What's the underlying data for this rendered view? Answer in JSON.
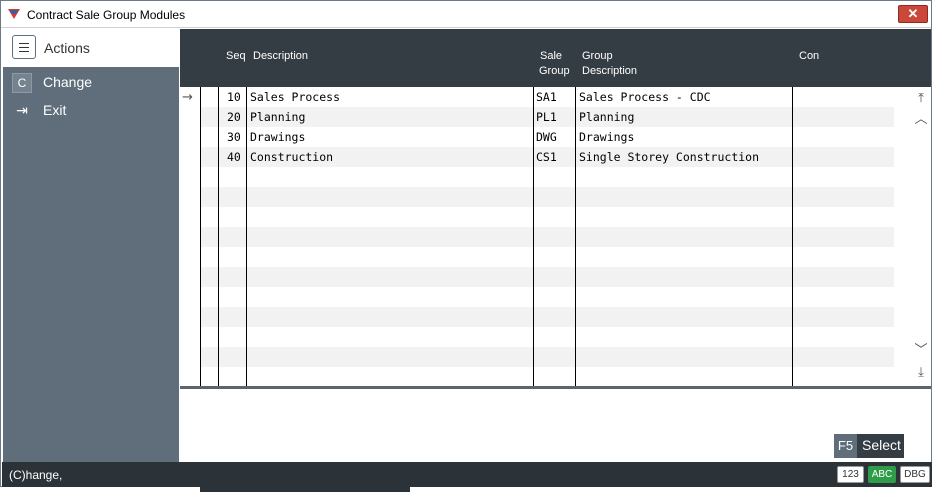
{
  "window": {
    "title": "Contract Sale Group Modules",
    "close_label": "✕"
  },
  "sidebar": {
    "title": "Actions",
    "items": [
      {
        "key": "C",
        "label": "Change"
      },
      {
        "key": "⇥",
        "label": "Exit"
      }
    ]
  },
  "grid": {
    "columns": {
      "seq": "Seq",
      "description": "Description",
      "sale_group_line1": "Sale",
      "sale_group_line2": "Group",
      "group_description_line1": "Group",
      "group_description_line2": "Description",
      "con": "Con"
    },
    "current_row_marker": "→",
    "rows": [
      {
        "seq": "10",
        "description": "Sales Process",
        "sale_group": "SA1",
        "group_description": "Sales Process - CDC",
        "con": ""
      },
      {
        "seq": "20",
        "description": "Planning",
        "sale_group": "PL1",
        "group_description": "Planning",
        "con": ""
      },
      {
        "seq": "30",
        "description": "Drawings",
        "sale_group": "DWG",
        "group_description": "Drawings",
        "con": ""
      },
      {
        "seq": "40",
        "description": "Construction",
        "sale_group": "CS1",
        "group_description": "Single Storey Construction",
        "con": ""
      }
    ],
    "scroll": {
      "top": "⤒",
      "up": "︿",
      "down": "﹀",
      "bottom": "⤓"
    }
  },
  "select_button": {
    "key": "F5",
    "label": "Select"
  },
  "statusbar": {
    "text": "(C)hange,",
    "badges": {
      "numeric": "123",
      "alpha": "ABC",
      "debug": "DBG"
    }
  },
  "icons": {
    "app": "app-logo-icon",
    "menu": "hamburger-icon"
  },
  "colors": {
    "header_bg": "#343d44",
    "sidebar_bg": "#5f6e7a",
    "close_bg": "#c9483a",
    "abc_badge": "#2e9c48"
  }
}
